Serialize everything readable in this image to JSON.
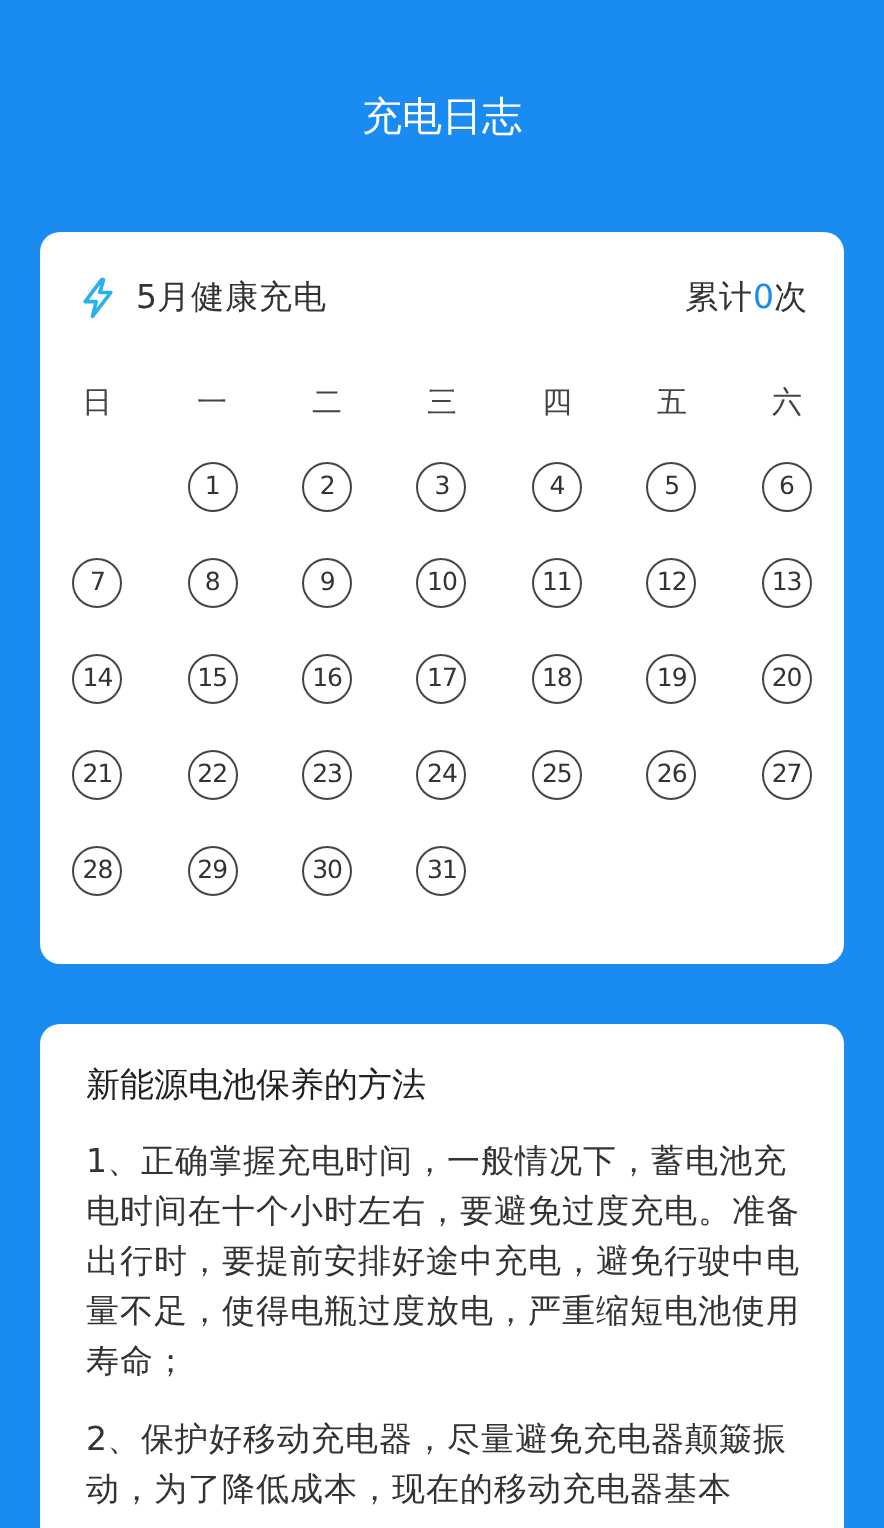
{
  "header": {
    "title": "充电日志"
  },
  "calendar": {
    "title": "5月健康充电",
    "total": {
      "prefix": "累计",
      "count": "0",
      "suffix": "次"
    },
    "weekdays": [
      "日",
      "一",
      "二",
      "三",
      "四",
      "五",
      "六"
    ],
    "weeks": [
      [
        "1",
        "2",
        "3",
        "4",
        "5",
        "6"
      ],
      [
        "7",
        "8",
        "9",
        "10",
        "11",
        "12",
        "13"
      ],
      [
        "14",
        "15",
        "16",
        "17",
        "18",
        "19",
        "20"
      ],
      [
        "21",
        "22",
        "23",
        "24",
        "25",
        "26",
        "27"
      ],
      [
        "28",
        "29",
        "30",
        "31"
      ]
    ]
  },
  "article": {
    "title": "新能源电池保养的方法",
    "paragraphs": [
      "1、正确掌握充电时间，一般情况下，蓄电池充电时间在十个小时左右，要避免过度充电。准备出行时，要提前安排好途中充电，避免行驶中电量不足，使得电瓶过度放电，严重缩短电池使用寿命；",
      "2、保护好移动充电器，尽量避免充电器颠簸振动，为了降低成本，现在的移动充电器基本"
    ]
  }
}
